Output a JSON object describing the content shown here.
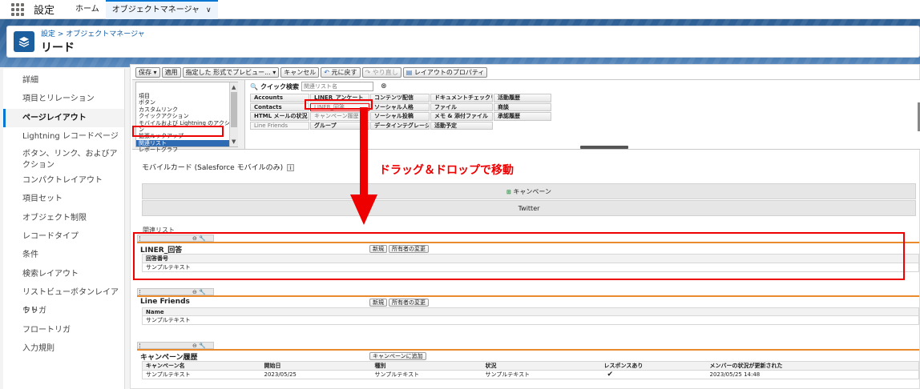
{
  "topbar": {
    "app_name": "設定",
    "tabs": [
      {
        "label": "ホーム"
      },
      {
        "label": "オブジェクトマネージャ"
      }
    ]
  },
  "header": {
    "breadcrumb": "設定 > オブジェクトマネージャ",
    "title": "リード"
  },
  "sidebar": {
    "items": [
      {
        "label": "詳細"
      },
      {
        "label": "項目とリレーション"
      },
      {
        "label": "ページレイアウト"
      },
      {
        "label": "Lightning レコードページ"
      },
      {
        "label": "ボタン、リンク、およびアクション"
      },
      {
        "label": "コンパクトレイアウト"
      },
      {
        "label": "項目セット"
      },
      {
        "label": "オブジェクト制限"
      },
      {
        "label": "レコードタイプ"
      },
      {
        "label": "条件"
      },
      {
        "label": "検索レイアウト"
      },
      {
        "label": "リストビューボタンレイアウト"
      },
      {
        "label": "トリガ"
      },
      {
        "label": "フロートリガ"
      },
      {
        "label": "入力規則"
      }
    ]
  },
  "toolbar": {
    "save": "保存 ▾",
    "apply": "適用",
    "preview": "指定した 形式でプレビュー... ▾",
    "cancel": "キャンセル",
    "undo": "元に戻す",
    "redo": "やり直し",
    "layout_props": "レイアウトのプロパティ"
  },
  "palette": {
    "categories": [
      {
        "label": "項目"
      },
      {
        "label": "ボタン"
      },
      {
        "label": "カスタムリンク"
      },
      {
        "label": "クイックアクション"
      },
      {
        "label": "モバイルおよび Lightning のアクション"
      },
      {
        "label": "拡張ルックアップ"
      },
      {
        "label": "関連リスト"
      },
      {
        "label": "レポートグラフ"
      }
    ],
    "quick_search_label": "クイック検索",
    "quick_search_placeholder": "関連リスト名",
    "items": [
      {
        "label": "Accounts"
      },
      {
        "label": "LINER_アンケート"
      },
      {
        "label": "コンテンツ配信"
      },
      {
        "label": "ドキュメントチェックリスト項目"
      },
      {
        "label": "活動履歴"
      },
      {
        "label": "Contacts"
      },
      {
        "label": "LINER_回答"
      },
      {
        "label": "ソーシャル人格"
      },
      {
        "label": "ファイル"
      },
      {
        "label": "商談"
      },
      {
        "label": "HTML メールの状況"
      },
      {
        "label": "キャンペーン履歴"
      },
      {
        "label": "ソーシャル投稿"
      },
      {
        "label": "メモ & 添付ファイル"
      },
      {
        "label": "承認履歴"
      },
      {
        "label": "Line Friends"
      },
      {
        "label": "グループ"
      },
      {
        "label": "データインテグレーションルール"
      },
      {
        "label": "活動予定"
      }
    ]
  },
  "mobile_card": {
    "title": "モバイルカード (Salesforce モバイルのみ)",
    "info": "i",
    "campaign": "キャンペーン",
    "twitter": "Twitter"
  },
  "related_lists": {
    "label": "関連リスト",
    "new_btn": "新規",
    "owner_btn": "所有者の変更",
    "add_campaign_btn": "キャンペーンに追加",
    "liner": {
      "title": "LINER_回答",
      "column": "回答番号",
      "value": "サンプルテキスト"
    },
    "line_friends": {
      "title": "Line Friends",
      "column": "Name",
      "value": "サンプルテキスト"
    },
    "campaign_history": {
      "title": "キャンペーン履歴",
      "columns": [
        "キャンペーン名",
        "開始日",
        "種別",
        "状況",
        "レスポンスあり",
        "メンバーの状況が更新された"
      ],
      "row": [
        "サンプルテキスト",
        "2023/05/25",
        "サンプルテキスト",
        "サンプルテキスト",
        "✔",
        "2023/05/25 14:48"
      ]
    }
  },
  "annotation": {
    "text": "ドラッグ＆ドロップで移動"
  },
  "colors": {
    "annotation_red": "#ee0000",
    "brand_blue": "#0176d3",
    "section_rule_orange": "#e98a2d"
  }
}
